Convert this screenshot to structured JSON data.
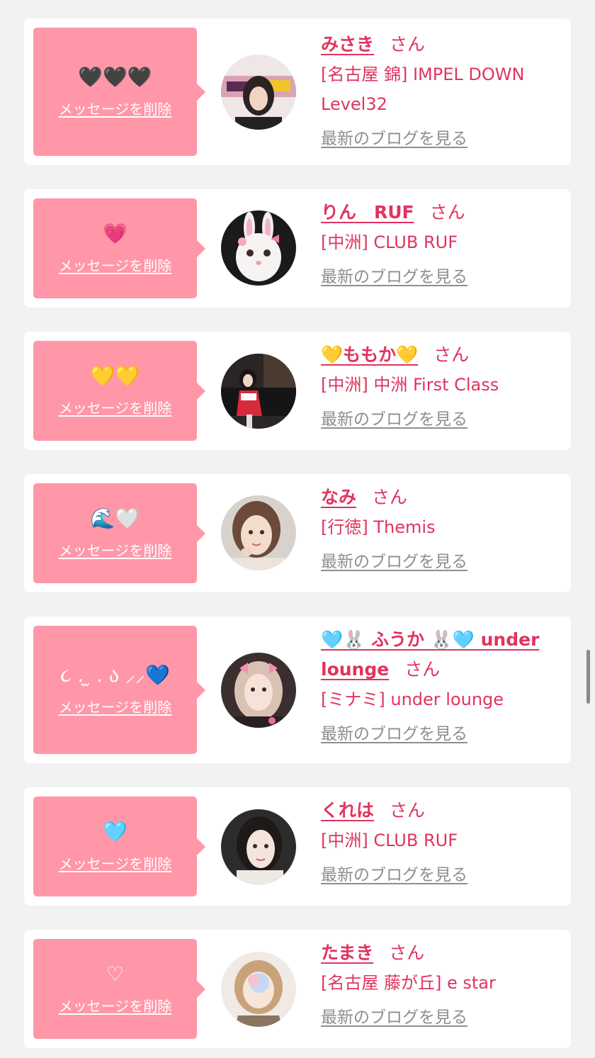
{
  "cards": [
    {
      "message": "🖤🖤🖤",
      "delete_label": "メッセージを削除",
      "name": "みさき",
      "honorific": "さん",
      "shop": "[名古屋 錦] IMPEL DOWN Level32",
      "blog_label": "最新のブログを見る"
    },
    {
      "message": "💗",
      "delete_label": "メッセージを削除",
      "name": "りん　RUF",
      "honorific": "さん",
      "shop": "[中洲] CLUB RUF",
      "blog_label": "最新のブログを見る"
    },
    {
      "message": "💛💛",
      "delete_label": "メッセージを削除",
      "name": "💛ももか💛",
      "honorific": "さん",
      "shop": "[中洲] 中洲 First Class",
      "blog_label": "最新のブログを見る"
    },
    {
      "message": "🌊🤍",
      "delete_label": "メッセージを削除",
      "name": "なみ",
      "honorific": "さん",
      "shop": "[行徳] Themis",
      "blog_label": "最新のブログを見る"
    },
    {
      "message": "૮ . ̫ . ა ⸝⸝💙",
      "delete_label": "メッセージを削除",
      "name": "🩵🐰 ふうか 🐰🩵 under lounge",
      "honorific": "さん",
      "shop": "[ミナミ] under lounge",
      "blog_label": "最新のブログを見る"
    },
    {
      "message": "🩵",
      "delete_label": "メッセージを削除",
      "name": "くれは",
      "honorific": "さん",
      "shop": "[中洲] CLUB RUF",
      "blog_label": "最新のブログを見る"
    },
    {
      "message": "♡",
      "delete_label": "メッセージを削除",
      "name": "たまき",
      "honorific": "さん",
      "shop": "[名古屋 藤が丘] e star",
      "blog_label": "最新のブログを見る"
    }
  ],
  "colors": {
    "background": "#f2f2f2",
    "card": "#ffffff",
    "bubble": "#ff97a8",
    "accent": "#e0345f",
    "link_gray": "#8e8e8e"
  }
}
